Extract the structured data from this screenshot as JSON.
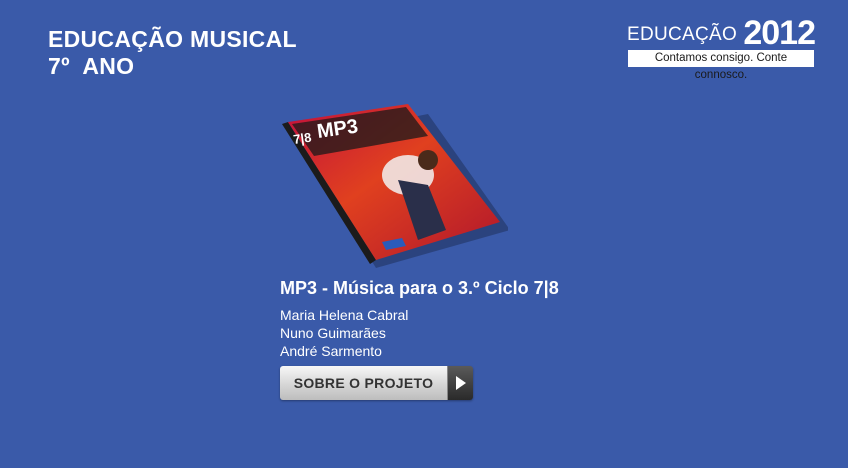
{
  "header": {
    "title_line1": "EDUCAÇÃO MUSICAL",
    "title_line2": "7º  ANO"
  },
  "brand": {
    "word": "EDUCAÇÃO",
    "year": "2012",
    "slogan": "Contamos consigo. Conte connosco."
  },
  "book": {
    "cover_title": "MP3",
    "cover_grade": "7|8",
    "title": "MP3 - Música para o 3.º Ciclo 7|8",
    "authors": [
      "Maria Helena Cabral",
      "Nuno Guimarães",
      "André Sarmento"
    ]
  },
  "actions": {
    "about_label": "SOBRE O PROJETO"
  },
  "colors": {
    "background": "#3a5aa9",
    "text": "#ffffff"
  },
  "icons": {
    "button_arrow": "play-arrow-icon"
  }
}
